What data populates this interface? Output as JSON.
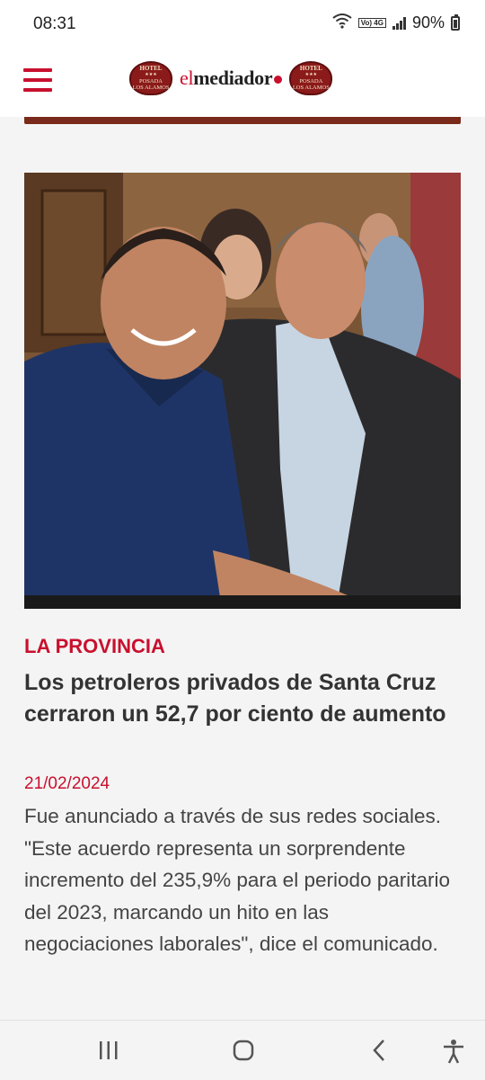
{
  "status_bar": {
    "time": "08:31",
    "battery_percent": "90%",
    "network_badge": "Vo) 4G",
    "icons": [
      "wifi-icon",
      "volte-icon",
      "signal-icon",
      "battery-icon"
    ]
  },
  "header": {
    "menu_icon": "hamburger-menu-icon",
    "brand_prefix": "el",
    "brand_name": "mediador",
    "sponsor_left": {
      "line1": "HOTEL",
      "line2": "POSADA",
      "line3": "LOS ALAMOS"
    },
    "sponsor_right": {
      "line1": "HOTEL",
      "line2": "POSADA",
      "line3": "LOS ALAMOS"
    },
    "accent_color": "#c8102e"
  },
  "article": {
    "section": "LA PROVINCIA",
    "headline": "Los petroleros privados de Santa Cruz cerraron un 52,7 por ciento de aumento",
    "date": "21/02/2024",
    "summary": "Fue anunciado a través de sus redes sociales. \"Este acuerdo representa un sorprendente incremento del 235,9% para el periodo paritario del 2023, marcando un hito en las negociaciones laborales\", dice el comunicado."
  },
  "nav_bar": {
    "buttons": [
      "recent-apps-icon",
      "home-icon",
      "back-icon",
      "accessibility-icon"
    ]
  }
}
